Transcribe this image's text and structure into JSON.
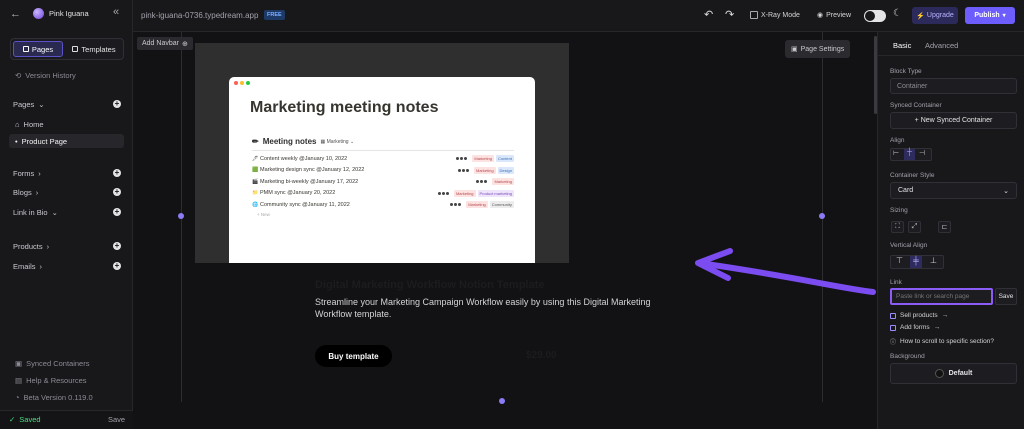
{
  "sidebar": {
    "site_name": "Pink Iguana",
    "tab_pages": "Pages",
    "tab_templates": "Templates",
    "version_history": "Version History",
    "pages_heading": "Pages",
    "page_home": "Home",
    "page_product": "Product Page",
    "forms": "Forms",
    "blogs": "Blogs",
    "link_in_bio": "Link in Bio",
    "products": "Products",
    "emails": "Emails",
    "synced_containers": "Synced Containers",
    "help": "Help & Resources",
    "beta_version": "Beta Version 0.119.0",
    "saved": "Saved",
    "save": "Save"
  },
  "topbar": {
    "url": "pink-iguana-0736.typedream.app",
    "plan_badge": "FREE",
    "xray": "X-Ray Mode",
    "preview": "Preview",
    "upgrade": "Upgrade",
    "publish": "Publish"
  },
  "canvas": {
    "add_navbar": "Add Navbar",
    "page_settings": "Page Settings",
    "notion": {
      "title": "Marketing meeting notes",
      "section": "Meeting notes",
      "filter": "Marketing",
      "rows": [
        {
          "icon": "🖊",
          "text": "Content weekly @January 10, 2022",
          "tags": [
            "Marketing",
            "Content"
          ]
        },
        {
          "icon": "🟩",
          "text": "Marketing design sync @January 12, 2022",
          "tags": [
            "Marketing",
            "Design"
          ]
        },
        {
          "icon": "🎬",
          "text": "Marketing bi-weekly @January 17, 2022",
          "tags": [
            "Marketing"
          ]
        },
        {
          "icon": "📁",
          "text": "PMM sync @January 20, 2022",
          "tags": [
            "Marketing",
            "Product marketing"
          ]
        },
        {
          "icon": "🌐",
          "text": "Community sync @January 11, 2022",
          "tags": [
            "Marketing",
            "Community"
          ]
        }
      ],
      "new": "+ New"
    },
    "product_title": "Digital Marketing Workflow Notion Template",
    "product_desc_1": "Streamline your Marketing Campaign Workflow easily by using this Digital Marketing",
    "product_desc_2": "Workflow template.",
    "buy_button": "Buy template",
    "price": "$29.00"
  },
  "panel": {
    "tab_basic": "Basic",
    "tab_advanced": "Advanced",
    "block_type_label": "Block Type",
    "block_type_value": "Container",
    "synced_label": "Synced Container",
    "new_synced": "+ New Synced Container",
    "align_label": "Align",
    "container_style_label": "Container Style",
    "container_style_value": "Card",
    "sizing_label": "Sizing",
    "vertical_align_label": "Vertical Align",
    "link_label": "Link",
    "link_placeholder": "Paste link or search page",
    "link_save": "Save",
    "sell_products": "Sell products",
    "add_forms": "Add forms",
    "scroll_help": "How to scroll to specific section?",
    "background_label": "Background",
    "background_value": "Default"
  },
  "colors": {
    "accent": "#6d5dfc",
    "annotation_arrow": "#7b4cf0",
    "highlight_border": "#8b5cf6"
  }
}
